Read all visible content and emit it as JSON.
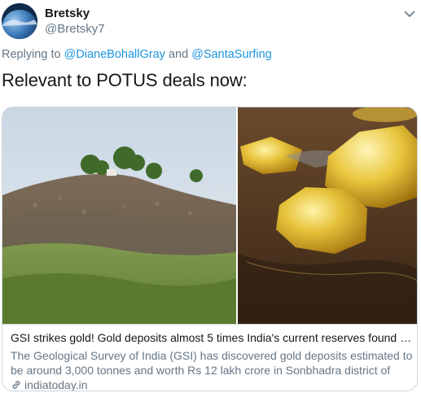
{
  "author": {
    "display_name": "Bretsky",
    "handle": "@Bretsky7"
  },
  "reply": {
    "prefix": "Replying to",
    "mention_1": "@DianeBohallGray",
    "conjunction": "and",
    "mention_2": "@SantaSurfing"
  },
  "tweet": {
    "text": "Relevant to POTUS deals now:"
  },
  "card": {
    "title": "GSI strikes gold! Gold deposits almost 5 times India's current reserves found in U...",
    "description": "The Geological Survey of India (GSI) has discovered gold deposits estimated to be around 3,000 tonnes and worth Rs 12 lakh crore in Sonbhadra district of Uttar ...",
    "domain": "indiatoday.in"
  },
  "icons": {
    "avatar": "earth-avatar",
    "menu": "chevron-down-icon",
    "link": "link-icon"
  },
  "colors": {
    "link_blue": "#1b95e0",
    "secondary_text": "#657786",
    "primary_text": "#14171a",
    "border": "#ccd6dd"
  }
}
